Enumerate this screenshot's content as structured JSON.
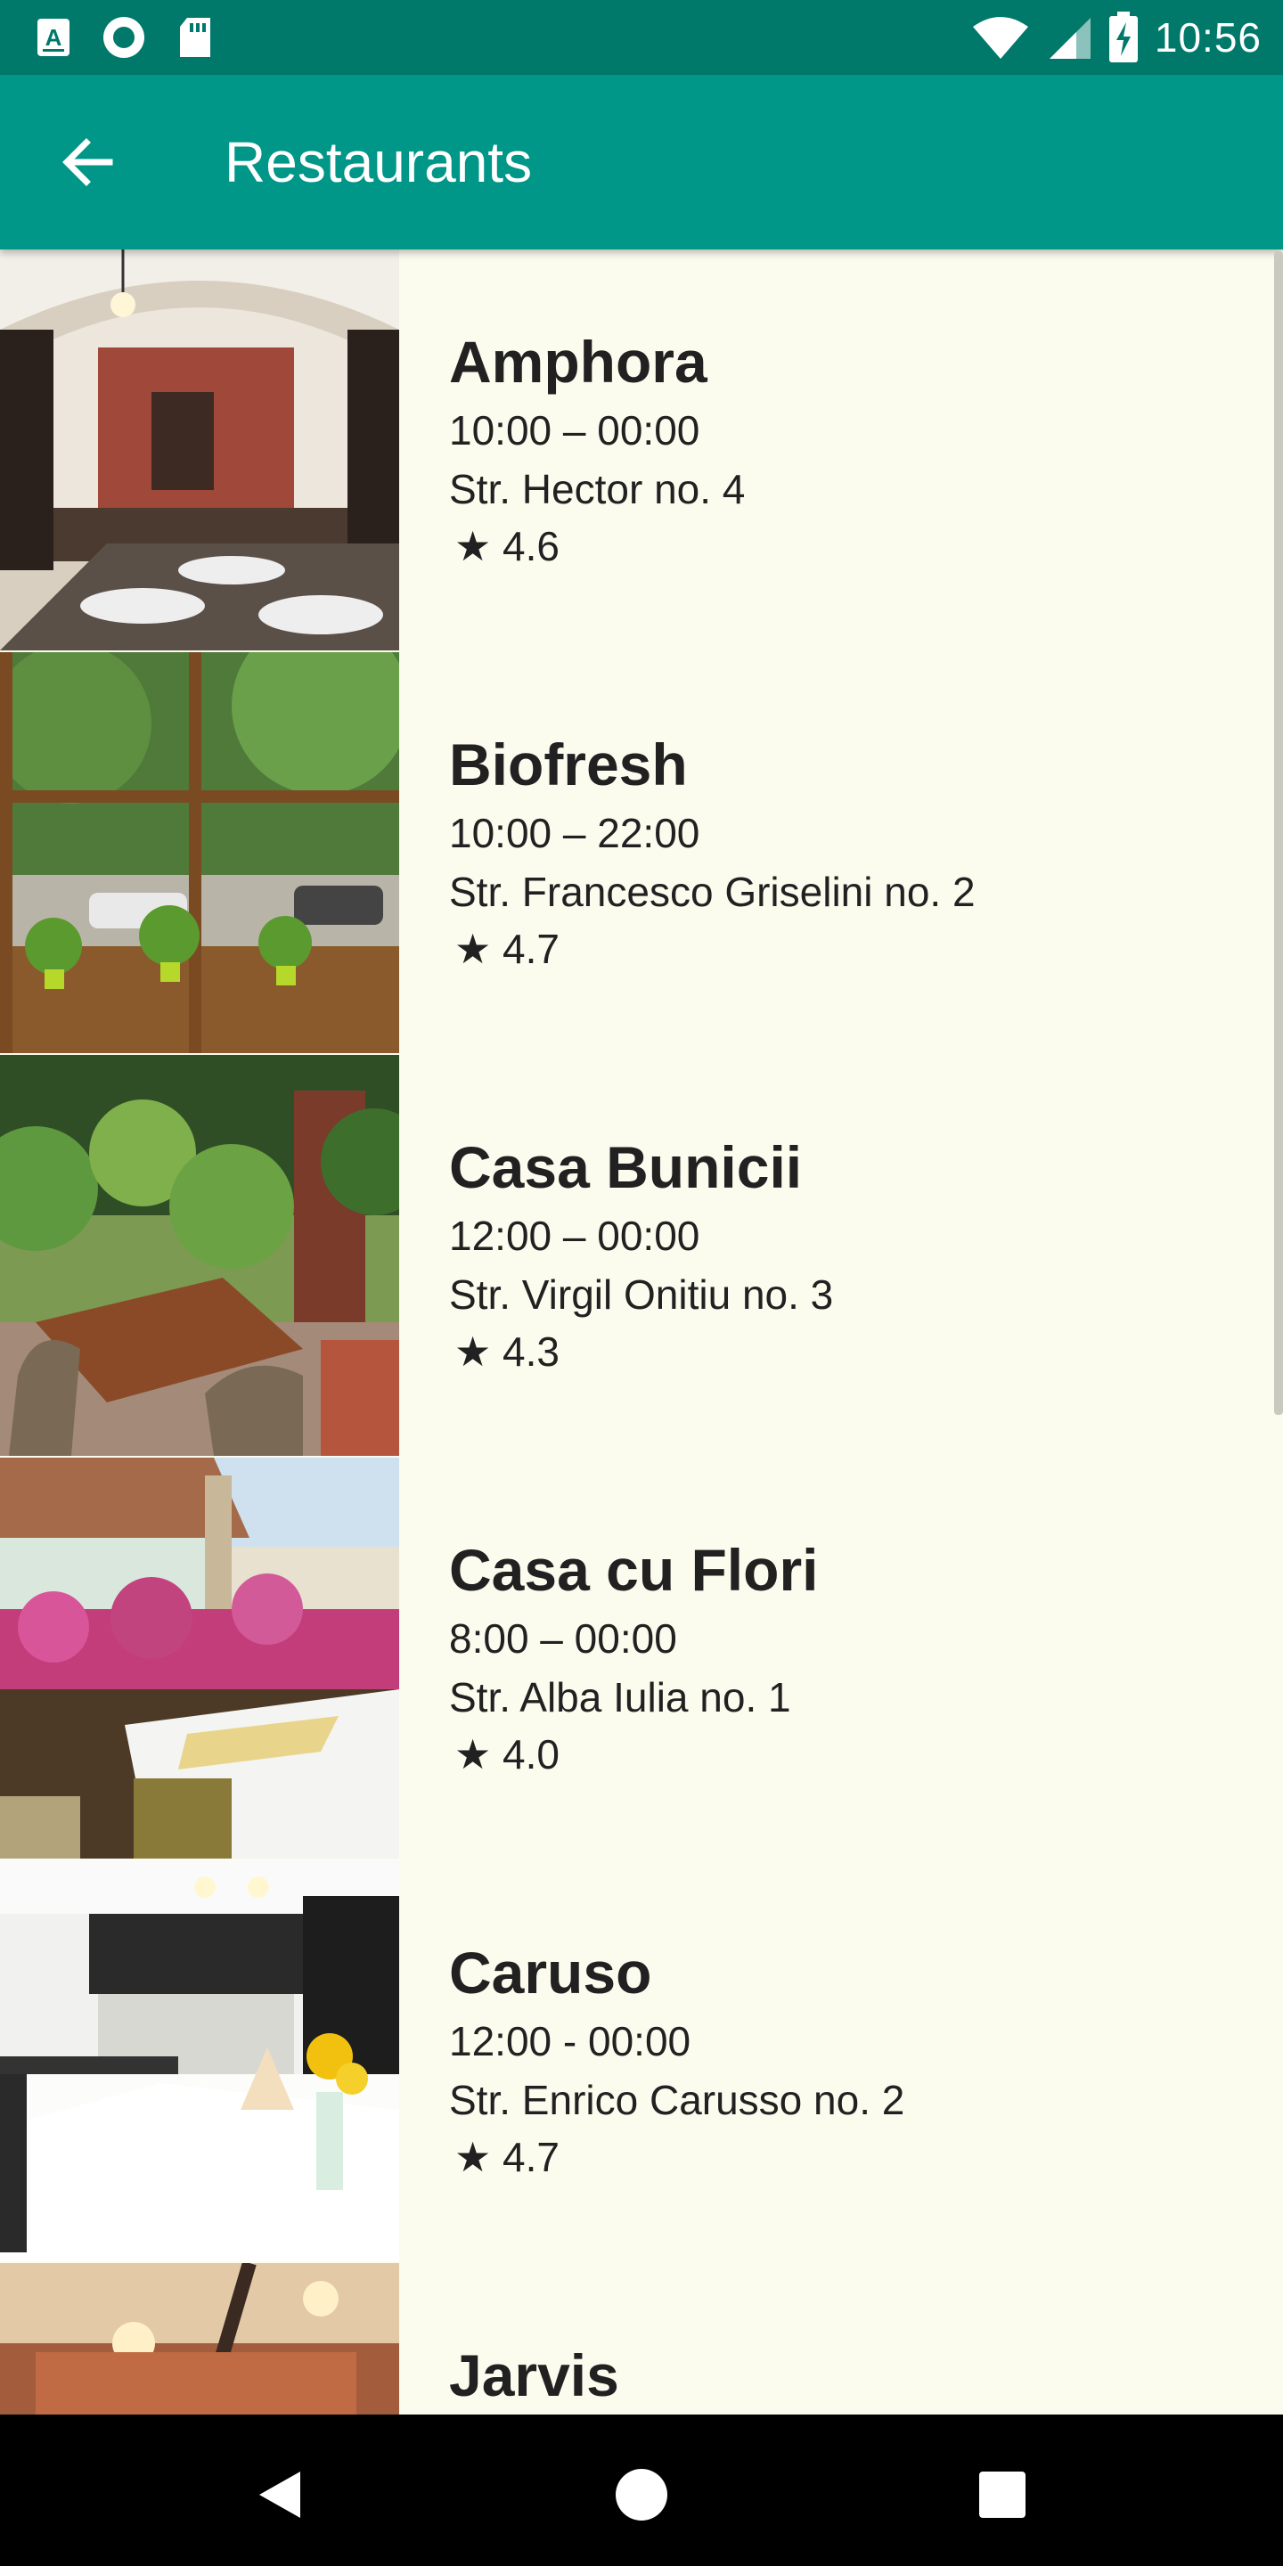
{
  "status_bar": {
    "time": "10:56",
    "left_icons": [
      "a-notification-icon",
      "circle-notification-icon",
      "sd-card-icon"
    ],
    "right_icons": [
      "wifi-icon",
      "signal-icon",
      "battery-charging-icon"
    ]
  },
  "app_bar": {
    "title": "Restaurants",
    "back_icon": "arrow-back-icon",
    "color": "#009688"
  },
  "restaurants": [
    {
      "name": "Amphora",
      "hours": "10:00 – 00:00",
      "address": "Str. Hector no. 4",
      "rating": "★ 4.6"
    },
    {
      "name": "Biofresh",
      "hours": "10:00 – 22:00",
      "address": "Str. Francesco Griselini no. 2",
      "rating": "★ 4.7"
    },
    {
      "name": "Casa Bunicii",
      "hours": "12:00 – 00:00",
      "address": "Str. Virgil Onitiu no. 3",
      "rating": "★ 4.3"
    },
    {
      "name": "Casa cu Flori",
      "hours": "8:00 – 00:00",
      "address": "Str. Alba Iulia no. 1",
      "rating": "★ 4.0"
    },
    {
      "name": "Caruso",
      "hours": "12:00 - 00:00",
      "address": "Str. Enrico Carusso no. 2",
      "rating": "★ 4.7"
    },
    {
      "name": "Jarvis",
      "hours": "",
      "address": "",
      "rating": ""
    }
  ],
  "nav_bar": {
    "buttons": [
      "back-triangle-icon",
      "home-circle-icon",
      "recents-square-icon"
    ]
  }
}
